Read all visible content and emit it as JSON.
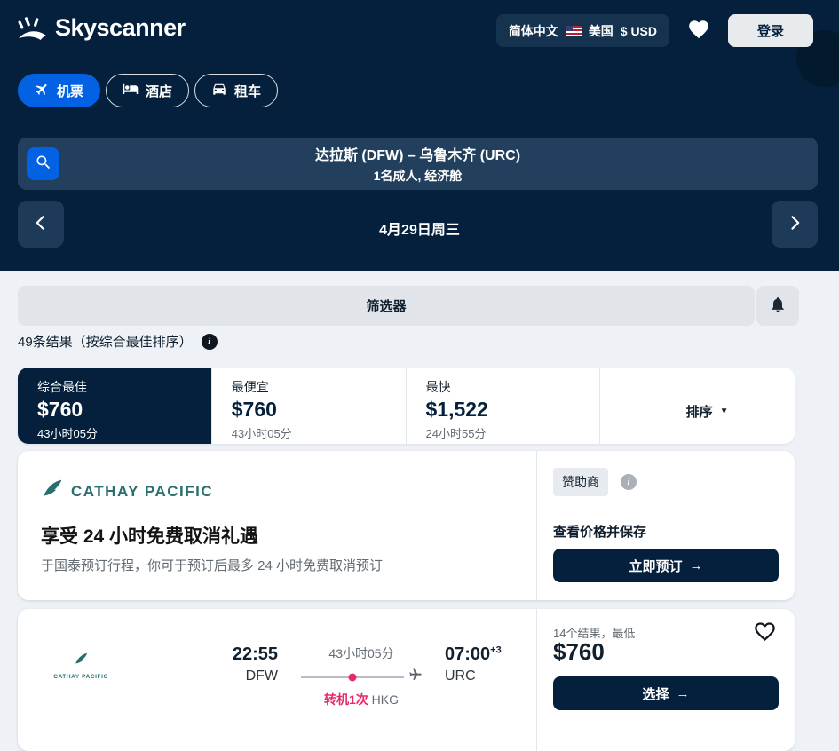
{
  "colors": {
    "brand_navy": "#05203c",
    "accent_blue": "#0362e3",
    "stop_pink": "#e8286d",
    "cathay_teal": "#2a6e6e",
    "page_bg": "#eef2f6"
  },
  "icons": {
    "arrow_right": "→",
    "caret_down": "▼",
    "info": "i"
  },
  "header": {
    "brand": "Skyscanner",
    "locale": {
      "language": "简体中文",
      "country": "美国",
      "currency": "$ USD"
    },
    "login_label": "登录",
    "nav": [
      {
        "label": "机票"
      },
      {
        "label": "酒店"
      },
      {
        "label": "租车"
      }
    ],
    "search": {
      "route": "达拉斯 (DFW) – 乌鲁木齐 (URC)",
      "travelers": "1名成人, 经济舱"
    },
    "date_label": "4月29日周三"
  },
  "filters": {
    "label": "筛选器"
  },
  "results_summary": "49条结果（按综合最佳排序）",
  "sort_tabs": [
    {
      "label": "综合最佳",
      "price": "$760",
      "duration": "43小时05分"
    },
    {
      "label": "最便宜",
      "price": "$760",
      "duration": "43小时05分"
    },
    {
      "label": "最快",
      "price": "$1,522",
      "duration": "24小时55分"
    }
  ],
  "sort_dropdown_label": "排序",
  "sponsored_card": {
    "airline": "CATHAY PACIFIC",
    "badge": "赞助商",
    "title": "享受 24 小时免费取消礼遇",
    "subtitle": "于国泰预订行程，你可于预订后最多 24 小时免费取消预订",
    "cta_caption": "查看价格并保存",
    "cta_label": "立即预订"
  },
  "flight_card": {
    "airline": "CATHAY PACIFIC",
    "depart_time": "22:55",
    "depart_airport": "DFW",
    "duration": "43小时05分",
    "stops": "转机1次",
    "stop_airport": "HKG",
    "arrive_time": "07:00",
    "arrive_day_offset": "+3",
    "arrive_airport": "URC",
    "deal_summary": "14个结果，最低",
    "price": "$760",
    "cta_label": "选择"
  }
}
